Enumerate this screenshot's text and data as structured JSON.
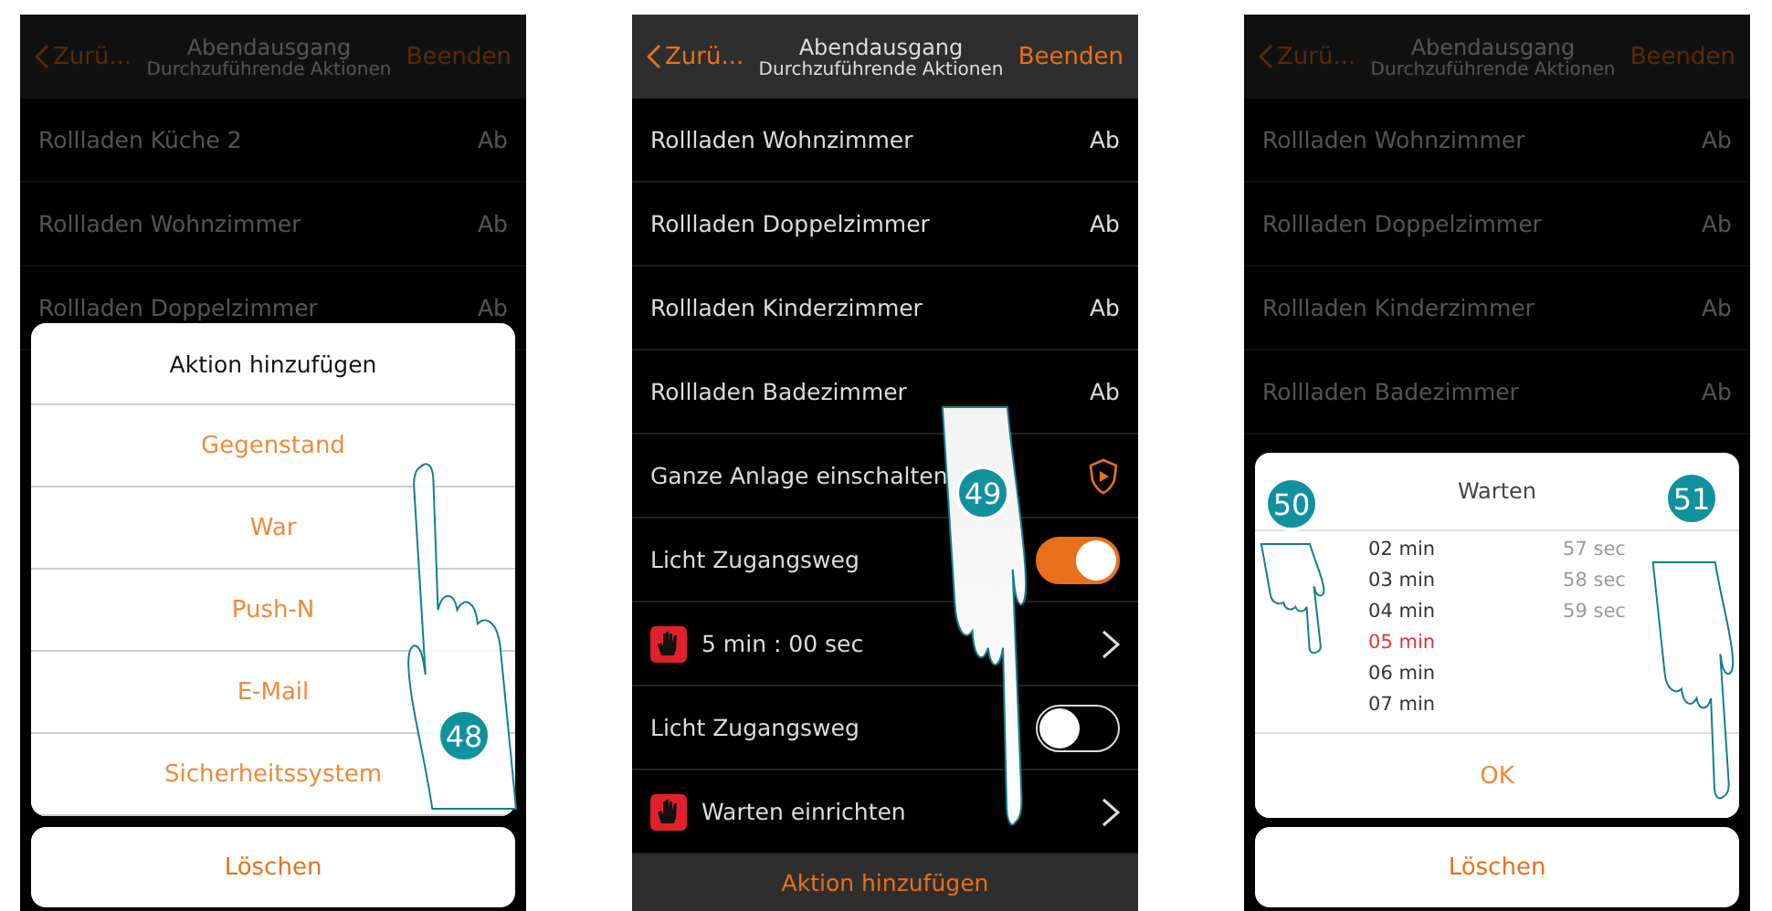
{
  "screens": [
    {
      "header": {
        "back": "Zurü...",
        "title": "Abendausgang",
        "subtitle": "Durchzuführende Aktionen",
        "action": "Beenden"
      },
      "dimmed": true,
      "rows": [
        {
          "kind": "value",
          "label": "Rollladen Küche 2",
          "value": "Ab"
        },
        {
          "kind": "value",
          "label": "Rollladen Wohnzimmer",
          "value": "Ab"
        },
        {
          "kind": "value",
          "label": "Rollladen Doppelzimmer",
          "value": "Ab"
        }
      ],
      "overlay": {
        "kind": "action_sheet",
        "title": "Aktion hinzufügen",
        "items": [
          "Gegenstand",
          "War",
          "Push-N",
          "E-Mail",
          "Sicherheitssystem"
        ],
        "cancel": "Löschen"
      },
      "steps": [
        "48"
      ]
    },
    {
      "header": {
        "back": "Zurü...",
        "title": "Abendausgang",
        "subtitle": "Durchzuführende Aktionen",
        "action": "Beenden"
      },
      "dimmed": false,
      "rows": [
        {
          "kind": "value",
          "label": "Rollladen Wohnzimmer",
          "value": "Ab"
        },
        {
          "kind": "value",
          "label": "Rollladen Doppelzimmer",
          "value": "Ab"
        },
        {
          "kind": "value",
          "label": "Rollladen Kinderzimmer",
          "value": "Ab"
        },
        {
          "kind": "value",
          "label": "Rollladen Badezimmer",
          "value": "Ab"
        },
        {
          "kind": "shield",
          "label": "Ganze Anlage einschalten"
        },
        {
          "kind": "toggle",
          "label": "Licht Zugangsweg",
          "on": true
        },
        {
          "kind": "wait",
          "label": "5 min : 00 sec"
        },
        {
          "kind": "toggle",
          "label": "Licht Zugangsweg",
          "on": false
        },
        {
          "kind": "wait",
          "label": "Warten einrichten"
        }
      ],
      "footer": "Aktion hinzufügen",
      "steps": [
        "49"
      ]
    },
    {
      "header": {
        "back": "Zurü...",
        "title": "Abendausgang",
        "subtitle": "Durchzuführende Aktionen",
        "action": "Beenden"
      },
      "dimmed": true,
      "rows": [
        {
          "kind": "value",
          "label": "Rollladen Wohnzimmer",
          "value": "Ab"
        },
        {
          "kind": "value",
          "label": "Rollladen Doppelzimmer",
          "value": "Ab"
        },
        {
          "kind": "value",
          "label": "Rollladen Kinderzimmer",
          "value": "Ab"
        },
        {
          "kind": "value",
          "label": "Rollladen Badezimmer",
          "value": "Ab"
        }
      ],
      "overlay": {
        "kind": "picker_dialog",
        "title": "Warten",
        "minutes": [
          {
            "label": "02 min",
            "selected": false
          },
          {
            "label": "03 min",
            "selected": false
          },
          {
            "label": "04 min",
            "selected": false
          },
          {
            "label": "05 min",
            "selected": true
          },
          {
            "label": "06 min",
            "selected": false
          },
          {
            "label": "07 min",
            "selected": false
          }
        ],
        "seconds": [
          {
            "label": "57 sec",
            "selected": false
          },
          {
            "label": "58 sec",
            "selected": false
          },
          {
            "label": "59 sec",
            "selected": false
          }
        ],
        "confirm": "OK",
        "cancel": "Löschen"
      },
      "steps": [
        "50",
        "51"
      ]
    }
  ]
}
